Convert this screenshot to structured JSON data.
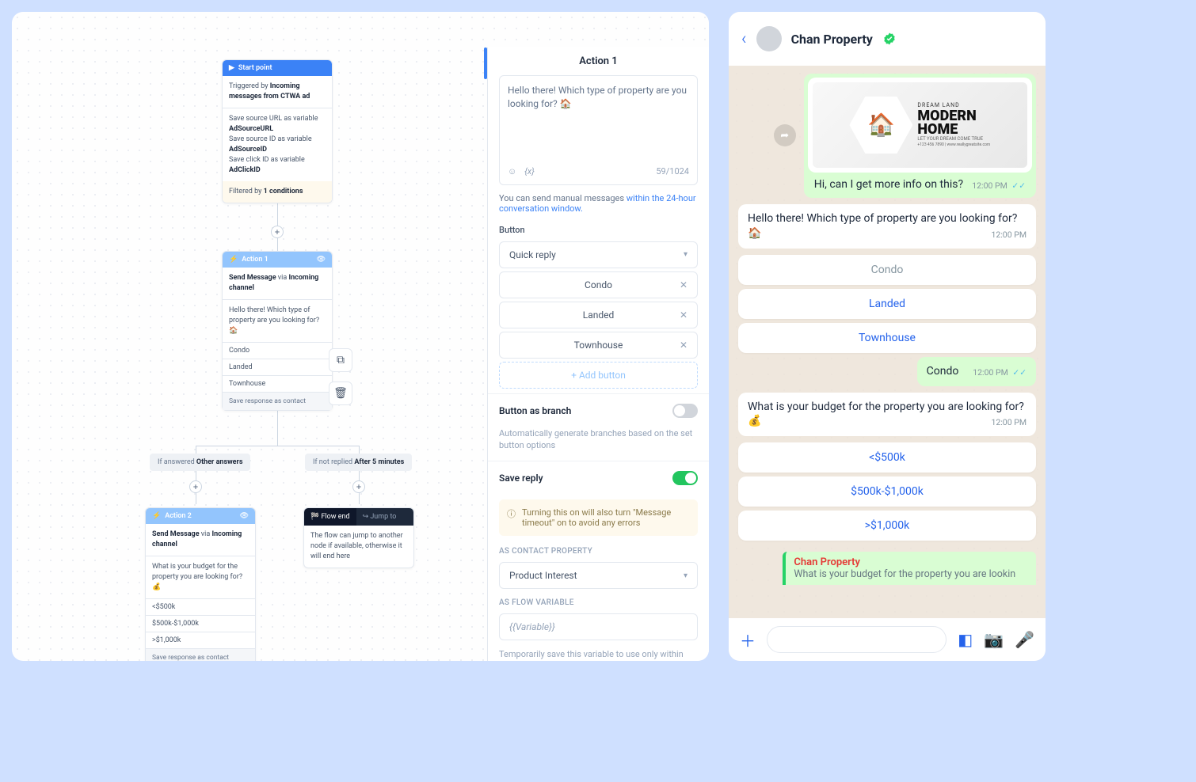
{
  "flow": {
    "start": {
      "title": "Start point",
      "trigger_pre": "Triggered by ",
      "trigger_bold": "Incoming messages from CTWA ad",
      "vars_l1": "Save source URL as variable",
      "vars_b1": "AdSourceURL",
      "vars_l2": "Save source ID as variable",
      "vars_b2": "AdSourceID",
      "vars_l3": "Save click ID as variable",
      "vars_b3": "AdClickID",
      "filter_pre": "Filtered by ",
      "filter_bold": "1 conditions"
    },
    "action1": {
      "title": "Action 1",
      "send_pre": "Send Message ",
      "send_via": "via ",
      "send_bold": "Incoming channel",
      "msg": "Hello there! Which type of property are you looking for? 🏠",
      "opt1": "Condo",
      "opt2": "Landed",
      "opt3": "Townhouse",
      "save": "Save response as contact"
    },
    "branch1_pre": "If answered ",
    "branch1_bold": "Other answers",
    "branch2_pre": "If not replied ",
    "branch2_bold": "After 5 minutes",
    "action2": {
      "title": "Action 2",
      "msg": "What is your budget for the property you are looking for? 💰",
      "opt1": "<$500k",
      "opt2": "$500k-$1,000k",
      "opt3": ">$1,000k",
      "save": "Save response as contact"
    },
    "end": {
      "tab1": "🏁 Flow end",
      "tab2": "↪ Jump to",
      "desc": "The flow can jump to another node if available, otherwise it will end here"
    }
  },
  "panel": {
    "title": "Action 1",
    "textarea": "Hello there! Which type of property are you looking for? 🏠",
    "counter": "59/1024",
    "emoji_icon": "☺",
    "var_icon": "{x}",
    "hint_pre": "You can send manual messages ",
    "hint_link": "within the 24-hour conversation window.",
    "button_label": "Button",
    "button_type": "Quick reply",
    "btn1": "Condo",
    "btn2": "Landed",
    "btn3": "Townhouse",
    "add": "+  Add button",
    "branch_label": "Button as branch",
    "branch_desc": "Automatically generate branches based on the set button options",
    "savereply": "Save reply",
    "warn": "Turning this on will also turn \"Message timeout\" on to avoid any errors",
    "warn_icon": "ⓘ",
    "contact_label": "AS CONTACT PROPERTY",
    "contact_value": "Product Interest",
    "flowvar_label": "AS FLOW VARIABLE",
    "flowvar_placeholder": "{{Variable}}",
    "flowvar_desc": "Temporarily save this variable to use only within this flow"
  },
  "phone": {
    "name": "Chan Property",
    "ad_l1": "DREAM LAND",
    "ad_l2a": "MODERN",
    "ad_l2b": "HOME",
    "ad_l3": "LET YOUR DREAM COME TRUE",
    "ad_l4": "+123 456 7890 | www.reallygreatsite.com",
    "user1": "Hi, can I get more info on this?",
    "ts": "12:00 PM",
    "bot1": "Hello there! Which type of property are you looking for? 🏠",
    "q1": "Condo",
    "q2": "Landed",
    "q3": "Townhouse",
    "user2": "Condo",
    "bot2": "What is your budget for the property you are looking for? 💰",
    "b1": "<$500k",
    "b2": "$500k-$1,000k",
    "b3": ">$1,000k",
    "reply_name": "Chan Property",
    "reply_msg": "What is your budget for the property you are lookin"
  }
}
